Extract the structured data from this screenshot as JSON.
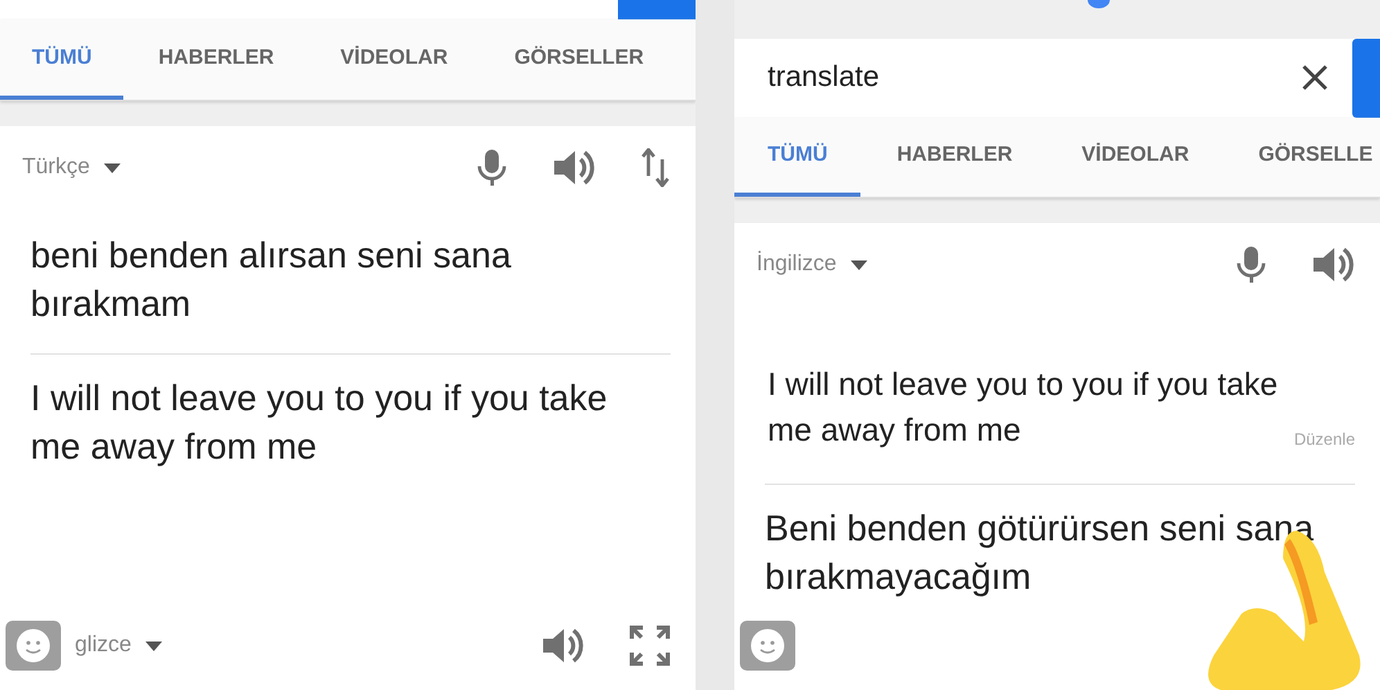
{
  "left_screen": {
    "tabs": [
      {
        "label": "TÜMÜ",
        "selected": true
      },
      {
        "label": "HABERLER",
        "selected": false
      },
      {
        "label": "VİDEOLAR",
        "selected": false
      },
      {
        "label": "GÖRSELLER",
        "selected": false
      }
    ],
    "source_language": "Türkçe",
    "source_text": "beni benden alırsan seni sana bırakmam",
    "translation": "I will not leave you to you if you take me away from me",
    "target_language": "glizce"
  },
  "right_screen": {
    "search": {
      "value": "translate"
    },
    "tabs": [
      {
        "label": "TÜMÜ",
        "selected": true
      },
      {
        "label": "HABERLER",
        "selected": false
      },
      {
        "label": "VİDEOLAR",
        "selected": false
      },
      {
        "label": "GÖRSELLE",
        "selected": false
      }
    ],
    "source_language": "İngilizce",
    "source_text": "I will not leave you to you if you take me away from me",
    "edit_link": "Düzenle",
    "translation": "Beni benden götürürsen seni sana bırakmayacağım"
  }
}
